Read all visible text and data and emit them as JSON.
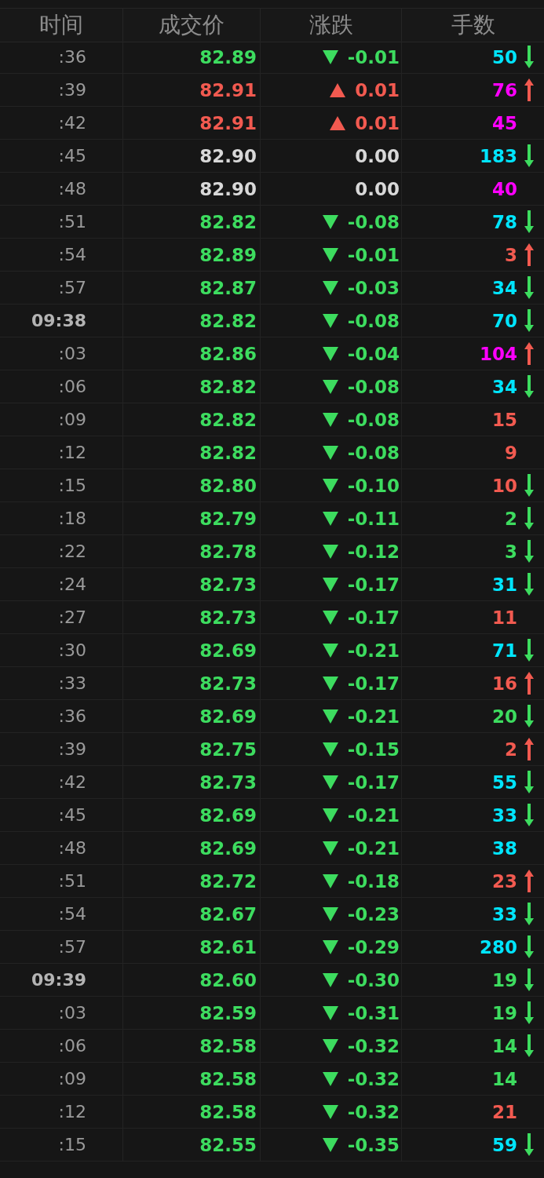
{
  "columns": [
    "时间",
    "成交价",
    "涨跌",
    "手数"
  ],
  "rows": [
    {
      "time": ":36",
      "full_minute": false,
      "price": "82.89",
      "rising": false,
      "falling": true,
      "change": "-0.01",
      "volume": "50",
      "color": "#00e5ff",
      "arrow_up": false,
      "arrow_down": true
    },
    {
      "time": ":39",
      "full_minute": false,
      "price": "82.91",
      "rising": true,
      "falling": false,
      "change": "0.01",
      "volume": "76",
      "color": "#ff00ff",
      "arrow_up": true,
      "arrow_down": false
    },
    {
      "time": ":42",
      "full_minute": false,
      "price": "82.91",
      "rising": true,
      "falling": false,
      "change": "0.01",
      "volume": "45",
      "color": "#ff00ff",
      "arrow_up": false,
      "arrow_down": false
    },
    {
      "time": ":45",
      "full_minute": false,
      "price": "82.90",
      "rising": false,
      "falling": false,
      "change": "0.00",
      "volume": "183",
      "color": "#00e5ff",
      "arrow_up": false,
      "arrow_down": true
    },
    {
      "time": ":48",
      "full_minute": false,
      "price": "82.90",
      "rising": false,
      "falling": false,
      "change": "0.00",
      "volume": "40",
      "color": "#ff00ff",
      "arrow_up": false,
      "arrow_down": false
    },
    {
      "time": ":51",
      "full_minute": false,
      "price": "82.82",
      "rising": false,
      "falling": true,
      "change": "-0.08",
      "volume": "78",
      "color": "#00e5ff",
      "arrow_up": false,
      "arrow_down": true
    },
    {
      "time": ":54",
      "full_minute": false,
      "price": "82.89",
      "rising": false,
      "falling": true,
      "change": "-0.01",
      "volume": "3",
      "color": "#f25a50",
      "arrow_up": true,
      "arrow_down": false
    },
    {
      "time": ":57",
      "full_minute": false,
      "price": "82.87",
      "rising": false,
      "falling": true,
      "change": "-0.03",
      "volume": "34",
      "color": "#00e5ff",
      "arrow_up": false,
      "arrow_down": true
    },
    {
      "time": "09:38",
      "full_minute": true,
      "price": "82.82",
      "rising": false,
      "falling": true,
      "change": "-0.08",
      "volume": "70",
      "color": "#00e5ff",
      "arrow_up": false,
      "arrow_down": true
    },
    {
      "time": ":03",
      "full_minute": false,
      "price": "82.86",
      "rising": false,
      "falling": true,
      "change": "-0.04",
      "volume": "104",
      "color": "#ff00ff",
      "arrow_up": true,
      "arrow_down": false
    },
    {
      "time": ":06",
      "full_minute": false,
      "price": "82.82",
      "rising": false,
      "falling": true,
      "change": "-0.08",
      "volume": "34",
      "color": "#00e5ff",
      "arrow_up": false,
      "arrow_down": true
    },
    {
      "time": ":09",
      "full_minute": false,
      "price": "82.82",
      "rising": false,
      "falling": true,
      "change": "-0.08",
      "volume": "15",
      "color": "#f25a50",
      "arrow_up": false,
      "arrow_down": false
    },
    {
      "time": ":12",
      "full_minute": false,
      "price": "82.82",
      "rising": false,
      "falling": true,
      "change": "-0.08",
      "volume": "9",
      "color": "#f25a50",
      "arrow_up": false,
      "arrow_down": false
    },
    {
      "time": ":15",
      "full_minute": false,
      "price": "82.80",
      "rising": false,
      "falling": true,
      "change": "-0.10",
      "volume": "10",
      "color": "#f25a50",
      "arrow_up": false,
      "arrow_down": true
    },
    {
      "time": ":18",
      "full_minute": false,
      "price": "82.79",
      "rising": false,
      "falling": true,
      "change": "-0.11",
      "volume": "2",
      "color": "#3ddc5f",
      "arrow_up": false,
      "arrow_down": true
    },
    {
      "time": ":22",
      "full_minute": false,
      "price": "82.78",
      "rising": false,
      "falling": true,
      "change": "-0.12",
      "volume": "3",
      "color": "#3ddc5f",
      "arrow_up": false,
      "arrow_down": true
    },
    {
      "time": ":24",
      "full_minute": false,
      "price": "82.73",
      "rising": false,
      "falling": true,
      "change": "-0.17",
      "volume": "31",
      "color": "#00e5ff",
      "arrow_up": false,
      "arrow_down": true
    },
    {
      "time": ":27",
      "full_minute": false,
      "price": "82.73",
      "rising": false,
      "falling": true,
      "change": "-0.17",
      "volume": "11",
      "color": "#f25a50",
      "arrow_up": false,
      "arrow_down": false
    },
    {
      "time": ":30",
      "full_minute": false,
      "price": "82.69",
      "rising": false,
      "falling": true,
      "change": "-0.21",
      "volume": "71",
      "color": "#00e5ff",
      "arrow_up": false,
      "arrow_down": true
    },
    {
      "time": ":33",
      "full_minute": false,
      "price": "82.73",
      "rising": false,
      "falling": true,
      "change": "-0.17",
      "volume": "16",
      "color": "#f25a50",
      "arrow_up": true,
      "arrow_down": false
    },
    {
      "time": ":36",
      "full_minute": false,
      "price": "82.69",
      "rising": false,
      "falling": true,
      "change": "-0.21",
      "volume": "20",
      "color": "#3ddc5f",
      "arrow_up": false,
      "arrow_down": true
    },
    {
      "time": ":39",
      "full_minute": false,
      "price": "82.75",
      "rising": false,
      "falling": true,
      "change": "-0.15",
      "volume": "2",
      "color": "#f25a50",
      "arrow_up": true,
      "arrow_down": false
    },
    {
      "time": ":42",
      "full_minute": false,
      "price": "82.73",
      "rising": false,
      "falling": true,
      "change": "-0.17",
      "volume": "55",
      "color": "#00e5ff",
      "arrow_up": false,
      "arrow_down": true
    },
    {
      "time": ":45",
      "full_minute": false,
      "price": "82.69",
      "rising": false,
      "falling": true,
      "change": "-0.21",
      "volume": "33",
      "color": "#00e5ff",
      "arrow_up": false,
      "arrow_down": true
    },
    {
      "time": ":48",
      "full_minute": false,
      "price": "82.69",
      "rising": false,
      "falling": true,
      "change": "-0.21",
      "volume": "38",
      "color": "#00e5ff",
      "arrow_up": false,
      "arrow_down": false
    },
    {
      "time": ":51",
      "full_minute": false,
      "price": "82.72",
      "rising": false,
      "falling": true,
      "change": "-0.18",
      "volume": "23",
      "color": "#f25a50",
      "arrow_up": true,
      "arrow_down": false
    },
    {
      "time": ":54",
      "full_minute": false,
      "price": "82.67",
      "rising": false,
      "falling": true,
      "change": "-0.23",
      "volume": "33",
      "color": "#00e5ff",
      "arrow_up": false,
      "arrow_down": true
    },
    {
      "time": ":57",
      "full_minute": false,
      "price": "82.61",
      "rising": false,
      "falling": true,
      "change": "-0.29",
      "volume": "280",
      "color": "#00e5ff",
      "arrow_up": false,
      "arrow_down": true
    },
    {
      "time": "09:39",
      "full_minute": true,
      "price": "82.60",
      "rising": false,
      "falling": true,
      "change": "-0.30",
      "volume": "19",
      "color": "#3ddc5f",
      "arrow_up": false,
      "arrow_down": true
    },
    {
      "time": ":03",
      "full_minute": false,
      "price": "82.59",
      "rising": false,
      "falling": true,
      "change": "-0.31",
      "volume": "19",
      "color": "#3ddc5f",
      "arrow_up": false,
      "arrow_down": true
    },
    {
      "time": ":06",
      "full_minute": false,
      "price": "82.58",
      "rising": false,
      "falling": true,
      "change": "-0.32",
      "volume": "14",
      "color": "#3ddc5f",
      "arrow_up": false,
      "arrow_down": true
    },
    {
      "time": ":09",
      "full_minute": false,
      "price": "82.58",
      "rising": false,
      "falling": true,
      "change": "-0.32",
      "volume": "14",
      "color": "#3ddc5f",
      "arrow_up": false,
      "arrow_down": false
    },
    {
      "time": ":12",
      "full_minute": false,
      "price": "82.58",
      "rising": false,
      "falling": true,
      "change": "-0.32",
      "volume": "21",
      "color": "#f25a50",
      "arrow_up": false,
      "arrow_down": false
    },
    {
      "time": ":15",
      "full_minute": false,
      "price": "82.55",
      "rising": false,
      "falling": true,
      "change": "-0.35",
      "volume": "59",
      "color": "#00e5ff",
      "arrow_up": false,
      "arrow_down": true
    }
  ]
}
